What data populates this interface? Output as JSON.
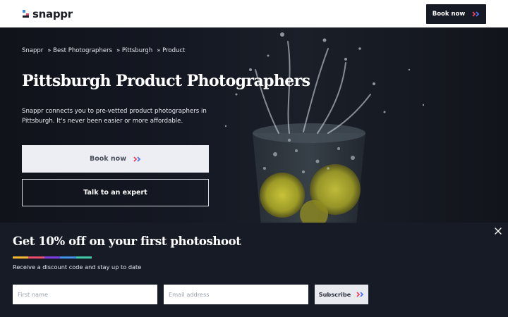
{
  "header": {
    "logo_text": "snappr",
    "book_now_label": "Book now",
    "book_icon": "double-chevron-right-icon"
  },
  "breadcrumb": {
    "items": [
      "Snappr",
      "» Best Photographers",
      "» Pittsburgh",
      "» Product"
    ]
  },
  "hero": {
    "title": "Pittsburgh Product Photographers",
    "description": "Snappr connects you to pre-vetted product photographers in Pittsburgh. It's never been easier or more affordable.",
    "book_now_label": "Book now",
    "expert_label": "Talk to an expert"
  },
  "promo": {
    "title": "Get 10% off on your first photoshoot",
    "subtitle": "Receive a discount code and stay up to date",
    "first_name_placeholder": "First name",
    "email_placeholder": "Email address",
    "subscribe_label": "Subscribe",
    "close_icon": "close-icon",
    "rainbow_colors": [
      "#f5b731",
      "#e84c6b",
      "#7b3fe4",
      "#3f8fe8",
      "#3fc7a8"
    ]
  },
  "colors": {
    "header_bg": "#ffffff",
    "dark_button": "#161a24",
    "promo_bg": "#161b26",
    "chevron_red": "#f0455f",
    "chevron_blue": "#4f73f5"
  }
}
